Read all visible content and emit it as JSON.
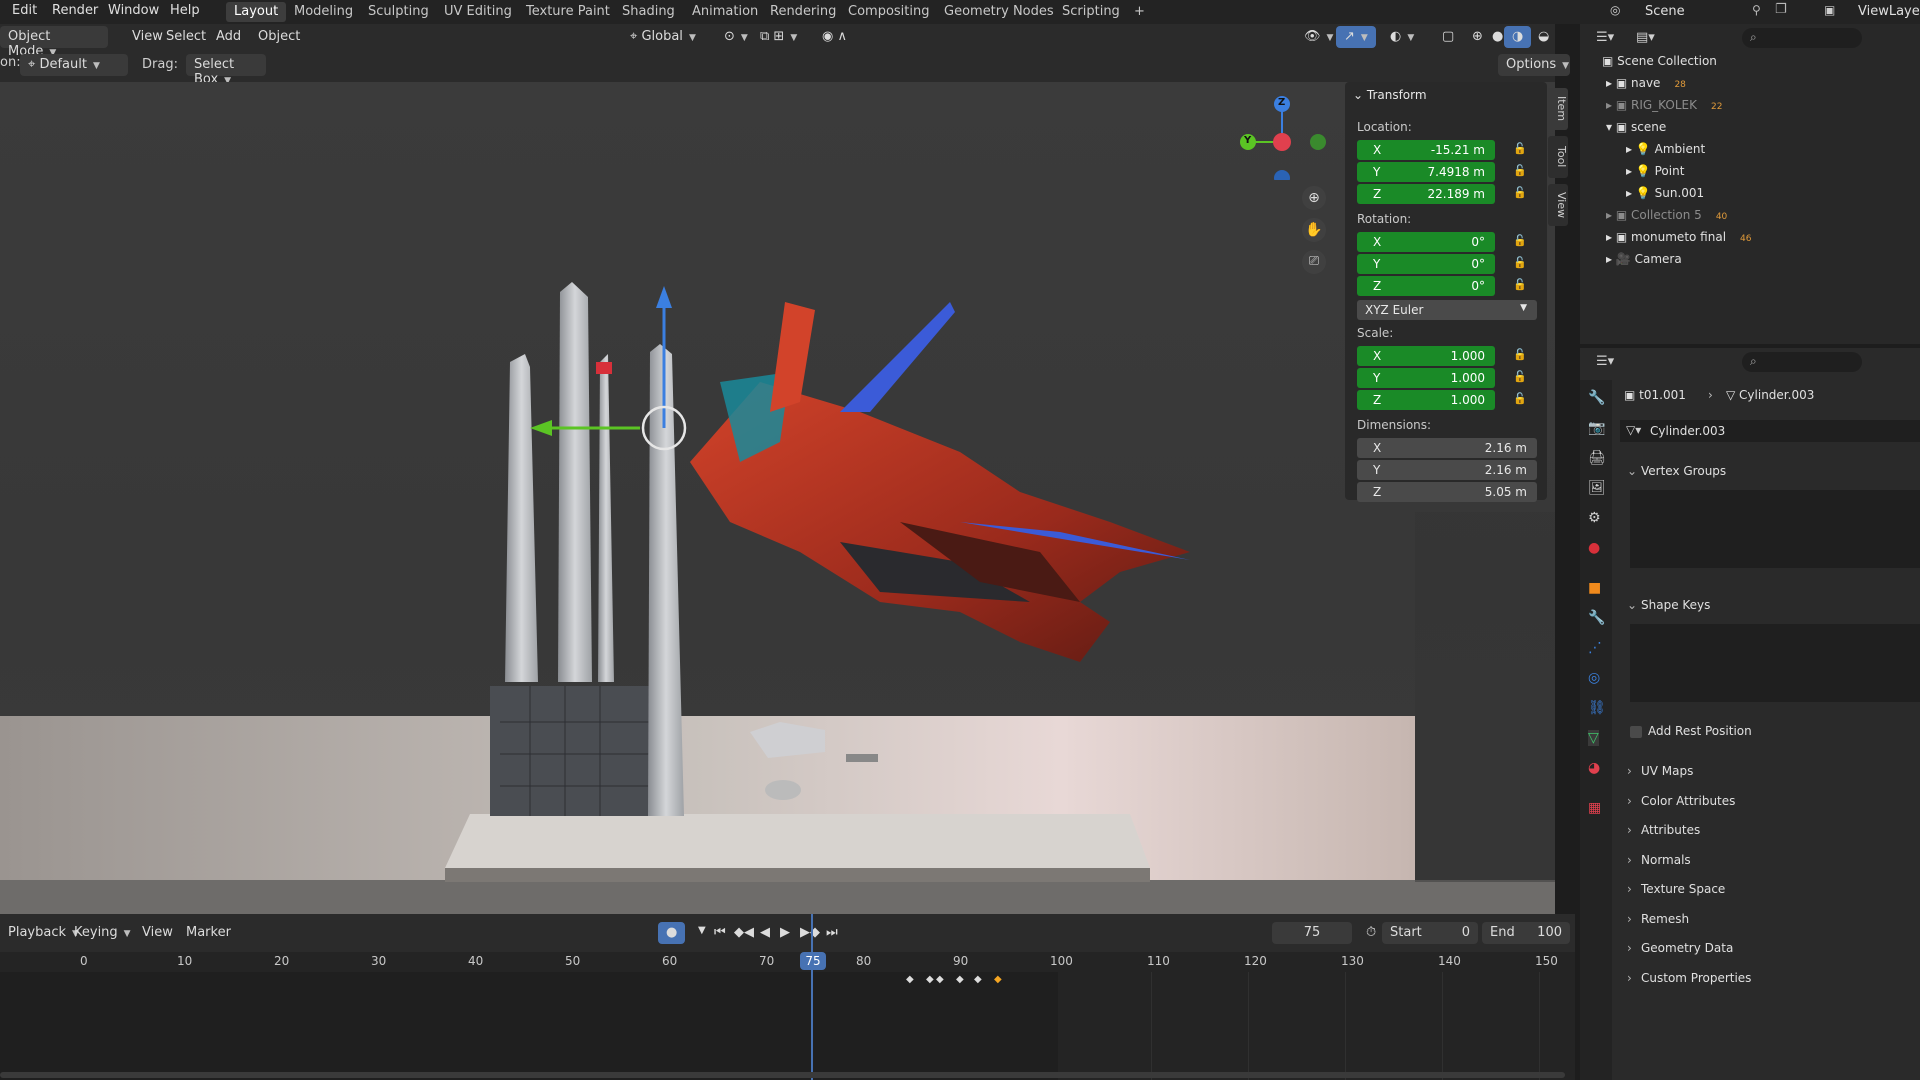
{
  "topbar": {
    "menus": [
      "Edit",
      "Render",
      "Window",
      "Help"
    ],
    "workspaces": [
      "Layout",
      "Modeling",
      "Sculpting",
      "UV Editing",
      "Texture Paint",
      "Shading",
      "Animation",
      "Rendering",
      "Compositing",
      "Geometry Nodes",
      "Scripting"
    ],
    "active_workspace": "Layout",
    "add_tab": "+",
    "scene_label": "Scene",
    "viewlayer_label": "ViewLayer"
  },
  "viewport_header": {
    "mode": "Object Mode",
    "menus": [
      "View",
      "Select",
      "Add",
      "Object"
    ],
    "orientation": "Global",
    "orientation_prefix": "on:",
    "orientation_default": "Default",
    "drag_label": "Drag:",
    "drag_value": "Select Box",
    "options": "Options"
  },
  "npanel": {
    "title": "Transform",
    "location_label": "Location:",
    "location": [
      {
        "axis": "X",
        "value": "-15.21 m"
      },
      {
        "axis": "Y",
        "value": "7.4918 m"
      },
      {
        "axis": "Z",
        "value": "22.189 m"
      }
    ],
    "rotation_label": "Rotation:",
    "rotation": [
      {
        "axis": "X",
        "value": "0°"
      },
      {
        "axis": "Y",
        "value": "0°"
      },
      {
        "axis": "Z",
        "value": "0°"
      }
    ],
    "rotation_mode": "XYZ Euler",
    "scale_label": "Scale:",
    "scale": [
      {
        "axis": "X",
        "value": "1.000"
      },
      {
        "axis": "Y",
        "value": "1.000"
      },
      {
        "axis": "Z",
        "value": "1.000"
      }
    ],
    "dimensions_label": "Dimensions:",
    "dimensions": [
      {
        "axis": "X",
        "value": "2.16 m"
      },
      {
        "axis": "Y",
        "value": "2.16 m"
      },
      {
        "axis": "Z",
        "value": "5.05 m"
      }
    ],
    "side_tabs": [
      "Item",
      "Tool",
      "View"
    ]
  },
  "gizmo": {
    "x": "X",
    "y": "Y",
    "z": "Z"
  },
  "timeline": {
    "menus": [
      "Playback",
      "Keying",
      "View",
      "Marker"
    ],
    "current_frame": "75",
    "start_label": "Start",
    "start": "0",
    "end_label": "End",
    "end": "100",
    "ticks": [
      "0",
      "10",
      "20",
      "30",
      "40",
      "50",
      "60",
      "70",
      "80",
      "90",
      "100",
      "110",
      "120",
      "130",
      "140",
      "150"
    ],
    "playhead_label": "75"
  },
  "outliner": {
    "root": "Scene Collection",
    "items": [
      {
        "label": "nave",
        "dim": false,
        "badge": "28"
      },
      {
        "label": "RIG_KOLEK",
        "dim": true,
        "badge": "22"
      },
      {
        "label": "scene",
        "dim": false,
        "badge": ""
      },
      {
        "label": "Ambient",
        "dim": false,
        "badge": ""
      },
      {
        "label": "Point",
        "dim": false,
        "badge": ""
      },
      {
        "label": "Sun.001",
        "dim": false,
        "badge": ""
      },
      {
        "label": "Collection 5",
        "dim": true,
        "badge": "40"
      },
      {
        "label": "monumeto final",
        "dim": false,
        "badge": "46"
      },
      {
        "label": "Camera",
        "dim": false,
        "badge": ""
      }
    ]
  },
  "properties": {
    "breadcrumb_object": "t01.001",
    "breadcrumb_mesh": "Cylinder.003",
    "mesh_name": "Cylinder.003",
    "vertex_groups": "Vertex Groups",
    "shape_keys": "Shape Keys",
    "add_rest_position": "Add Rest Position",
    "sections": [
      "UV Maps",
      "Color Attributes",
      "Attributes",
      "Normals",
      "Texture Space",
      "Remesh",
      "Geometry Data",
      "Custom Properties"
    ]
  },
  "colors": {
    "accent": "#4772b3",
    "field_green": "#1a8a27",
    "playhead": "#4772b3",
    "keyframe_selected": "#f5a623"
  }
}
